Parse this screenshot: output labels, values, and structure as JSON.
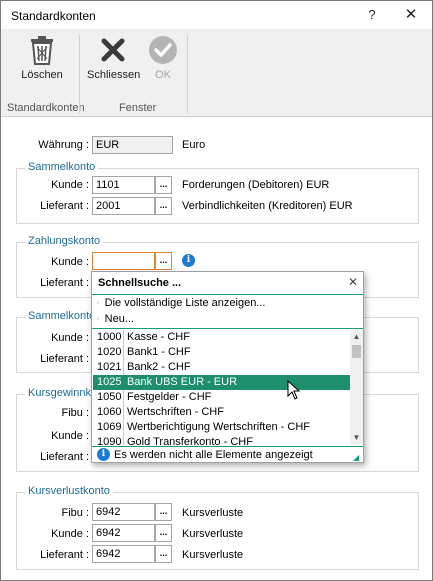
{
  "window": {
    "title": "Standardkonten",
    "help_glyph": "?",
    "close_glyph": "✕"
  },
  "ribbon": {
    "delete_label": "Löschen",
    "close_label": "Schliessen",
    "ok_label": "OK",
    "group_standardkonten": "Standardkonten",
    "group_fenster": "Fenster"
  },
  "currency": {
    "label": "Währung :",
    "value": "EUR",
    "desc": "Euro"
  },
  "sammelkonto": {
    "title": "Sammelkonto",
    "kunde_label": "Kunde :",
    "kunde_value": "1101",
    "kunde_desc": "Forderungen (Debitoren) EUR",
    "lieferant_label": "Lieferant :",
    "lieferant_value": "2001",
    "lieferant_desc": "Verbindlichkeiten (Kreditoren) EUR"
  },
  "zahlungskonto": {
    "title": "Zahlungskonto",
    "kunde_label": "Kunde :",
    "kunde_value": "",
    "lieferant_label": "Lieferant :"
  },
  "sammelkonto_v": {
    "title": "Sammelkonto V",
    "kunde_label": "Kunde :",
    "lieferant_label": "Lieferant :"
  },
  "kursgewinn": {
    "title": "Kursgewinnko",
    "fibu_label": "Fibu :",
    "kunde_label": "Kunde :",
    "lieferant_label": "Lieferant :"
  },
  "kursverlust": {
    "title": "Kursverlustkonto",
    "fibu_label": "Fibu :",
    "fibu_value": "6942",
    "fibu_desc": "Kursverluste",
    "kunde_label": "Kunde :",
    "kunde_value": "6942",
    "kunde_desc": "Kursverluste",
    "lieferant_label": "Lieferant :",
    "lieferant_value": "6942",
    "lieferant_desc": "Kursverluste"
  },
  "dots": "...",
  "popup": {
    "title": "Schnellsuche ...",
    "close_glyph": "✕",
    "action_full_list": "Die vollständige Liste anzeigen...",
    "action_new": "Neu...",
    "rows": [
      {
        "nr": "1000",
        "name": "Kasse - CHF"
      },
      {
        "nr": "1020",
        "name": "Bank1 - CHF"
      },
      {
        "nr": "1021",
        "name": "Bank2 - CHF"
      },
      {
        "nr": "1025",
        "name": "Bank UBS EUR - EUR",
        "selected": true
      },
      {
        "nr": "1050",
        "name": "Festgelder - CHF"
      },
      {
        "nr": "1060",
        "name": "Wertschriften - CHF"
      },
      {
        "nr": "1069",
        "name": "Wertberichtigung Wertschriften - CHF"
      },
      {
        "nr": "1090",
        "name": "Gold Transferkonto - CHF"
      }
    ],
    "footer": "Es werden nicht alle Elemente angezeigt"
  },
  "colors": {
    "accent_green": "#1e8f6c",
    "group_title_blue": "#1e6b96",
    "active_border": "#e0843a",
    "info_blue": "#1a7bd0"
  },
  "icons": [
    "trash-icon",
    "x-icon",
    "check-circle-icon",
    "info-icon",
    "mouse-cursor-icon"
  ]
}
